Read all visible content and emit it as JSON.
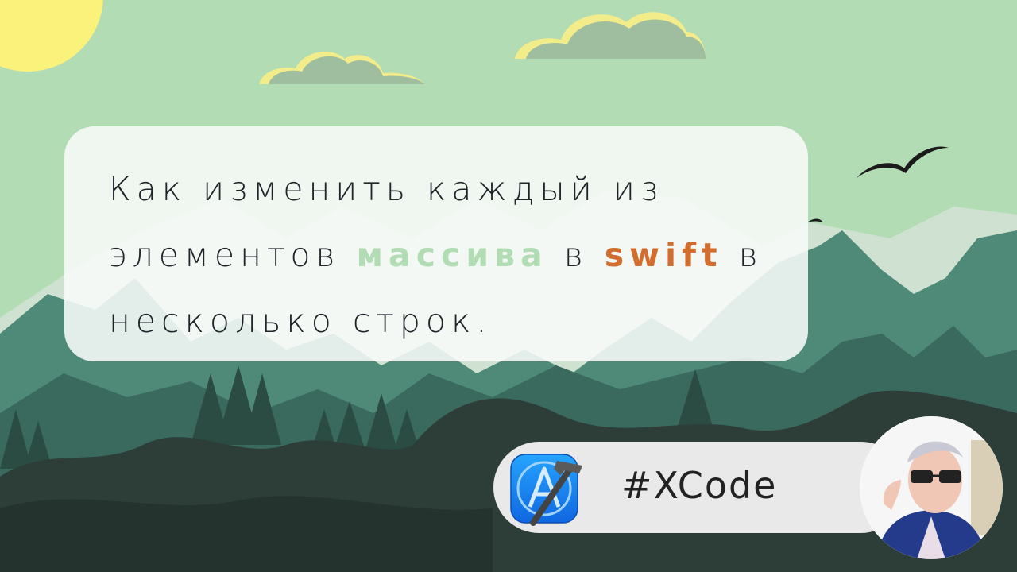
{
  "headline": {
    "line1": "Как изменить каждый из",
    "line2_before": "элементов ",
    "line2_highlight1": "массива",
    "line2_middle": " в ",
    "line2_highlight2": "swift",
    "line2_after": " в",
    "line3": "несколько строк."
  },
  "badge": {
    "hashtag": "#XCode",
    "icon": "xcode-icon"
  },
  "colors": {
    "sky": "#b2dcb4",
    "highlight_green": "#b2dcb4",
    "highlight_orange": "#d06d2f",
    "xcode_blue": "#1e8cf2"
  }
}
